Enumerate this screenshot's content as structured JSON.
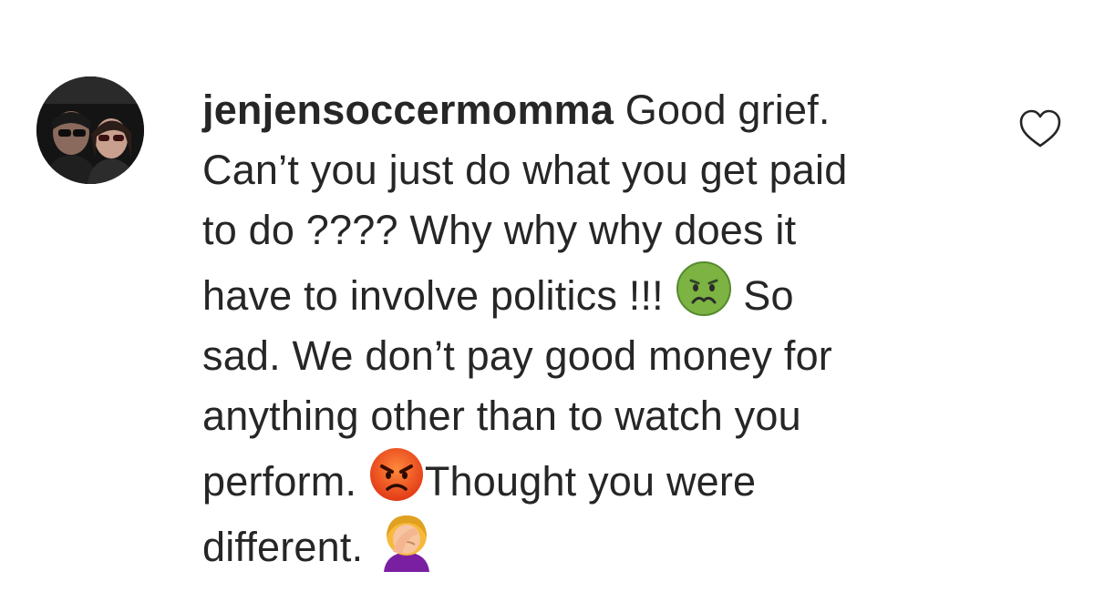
{
  "comment": {
    "username": "jenjensoccermomma",
    "lines": [
      " Good grief.",
      "Can’t you just do what you get paid",
      "to do ???? Why why why does it",
      "have to involve politics !!! ",
      " So",
      "sad. We don’t pay good money for",
      "anything other than to watch you",
      "perform. ",
      "Thought you were",
      "different. "
    ],
    "emojis": [
      "nauseated-face-icon",
      "pouting-face-icon",
      "woman-facepalming-icon"
    ]
  },
  "avatar": {
    "description_icon": "profile-photo-avatar"
  },
  "like": {
    "icon": "heart-outline-icon"
  },
  "colors": {
    "text": "#262626",
    "heart_stroke": "#262626",
    "background": "#ffffff"
  }
}
